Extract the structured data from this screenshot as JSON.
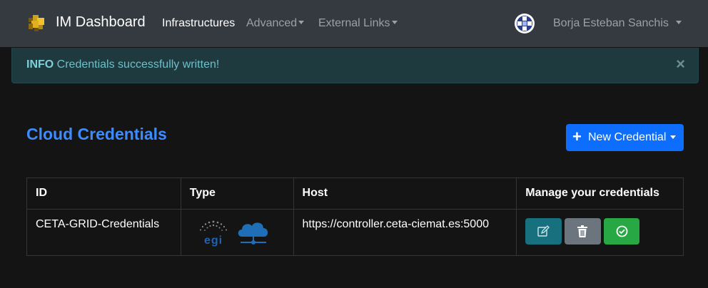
{
  "navbar": {
    "brand": "IM Dashboard",
    "links": [
      {
        "label": "Infrastructures",
        "active": true
      },
      {
        "label": "Advanced",
        "dropdown": true
      },
      {
        "label": "External Links",
        "dropdown": true
      }
    ],
    "user": "Borja Esteban Sanchis"
  },
  "alert": {
    "level": "INFO",
    "message": "Credentials successfully written!"
  },
  "page": {
    "title": "Cloud Credentials",
    "new_button": "New Credential"
  },
  "table": {
    "headers": [
      "ID",
      "Type",
      "Host",
      "Manage your credentials"
    ],
    "rows": [
      {
        "id": "CETA-GRID-Credentials",
        "type_icons": [
          "egi-logo",
          "cloud-network-icon"
        ],
        "host": "https://controller.ceta-ciemat.es:5000",
        "actions": [
          "edit-icon",
          "trash-icon",
          "check-circle-icon"
        ]
      }
    ]
  },
  "colors": {
    "navbar": "#343a40",
    "background": "#141414",
    "alert_bg": "#1e3a3f",
    "title": "#3d8bfd",
    "primary_button": "#0d6efd",
    "edit_button": "#17707e",
    "delete_button": "#6c757d",
    "select_button": "#28a745"
  }
}
